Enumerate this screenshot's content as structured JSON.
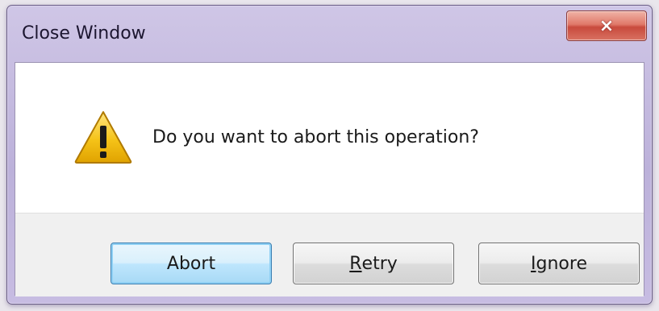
{
  "window": {
    "title": "Close Window",
    "close_label": "×"
  },
  "dialog": {
    "icon": "warning-icon",
    "message": "Do you want to abort this operation?"
  },
  "buttons": {
    "abort": {
      "label": "Abort"
    },
    "retry": {
      "mnemonic": "R",
      "rest": "etry"
    },
    "ignore": {
      "mnemonic": "I",
      "rest": "gnore"
    }
  },
  "colors": {
    "titlebar": "#c3b8de",
    "close_button": "#d8604f",
    "default_button_border": "#3c7fb1",
    "warning_yellow": "#f5c318"
  }
}
